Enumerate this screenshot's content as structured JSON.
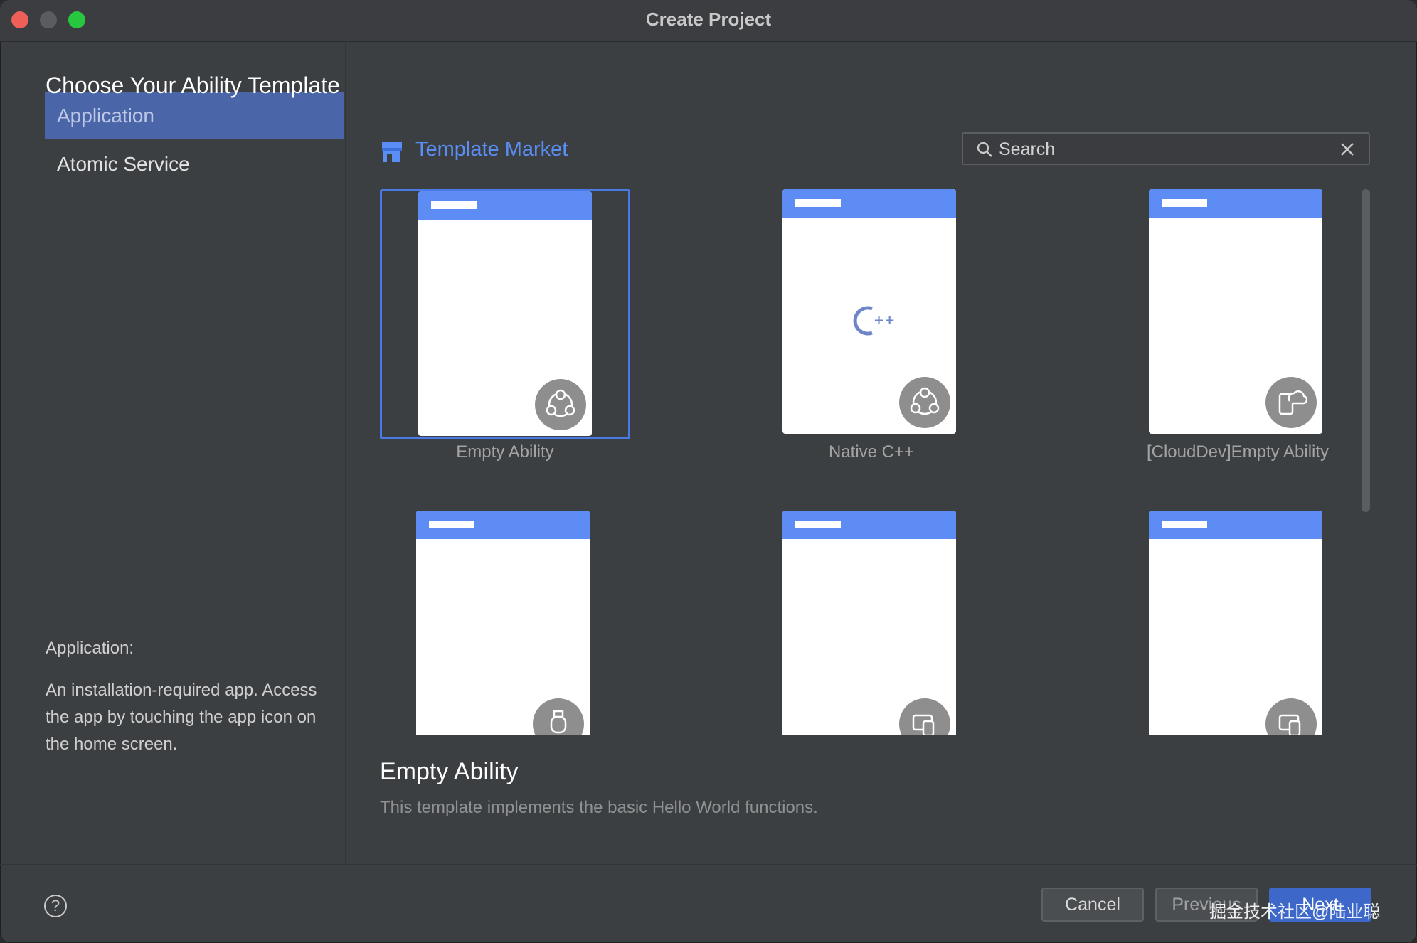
{
  "window": {
    "title": "Create Project"
  },
  "heading": "Choose Your Ability Template",
  "sidebar": {
    "items": [
      {
        "label": "Application",
        "active": true
      },
      {
        "label": "Atomic Service",
        "active": false
      }
    ],
    "description_title": "Application:",
    "description_body": "An installation-required app. Access the app by touching the app icon on the home screen."
  },
  "market": {
    "label": "Template Market"
  },
  "search": {
    "placeholder": "Search",
    "value": ""
  },
  "templates": [
    {
      "label": "Empty Ability",
      "badge": "nodes-icon",
      "selected": true
    },
    {
      "label": "Native C++",
      "badge": "nodes-icon",
      "selected": false
    },
    {
      "label": "[CloudDev]Empty Ability",
      "badge": "cloud-device-icon",
      "selected": false
    },
    {
      "label": "",
      "badge": "watch-icon",
      "selected": false
    },
    {
      "label": "",
      "badge": "multi-device-icon",
      "selected": false
    },
    {
      "label": "",
      "badge": "multi-device-icon",
      "selected": false
    }
  ],
  "detail": {
    "title": "Empty Ability",
    "description": "This template implements the basic Hello World functions."
  },
  "footer": {
    "cancel_label": "Cancel",
    "previous_label": "Previous",
    "next_label": "Next",
    "help_symbol": "?"
  },
  "watermark": "掘金技术社区@陆业聪",
  "colors": {
    "accent": "#5d8cf5",
    "selection": "#4a7ae8",
    "sidebar_active": "#4b66a8"
  }
}
